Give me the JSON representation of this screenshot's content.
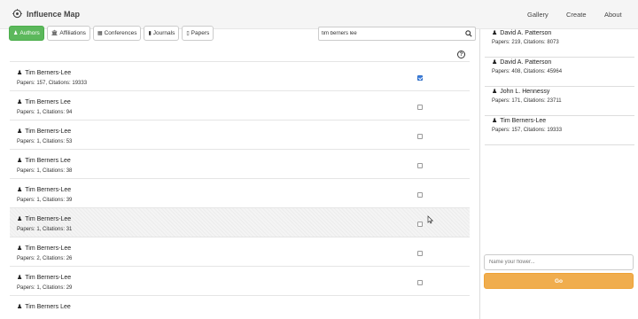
{
  "navbar": {
    "brand_icon": "flower-logo-icon",
    "brand_title": "Influence Map",
    "links": [
      "Gallery",
      "Create",
      "About"
    ]
  },
  "tabs": [
    {
      "label": "Authors",
      "icon": "person-icon",
      "active": true
    },
    {
      "label": "Affiliations",
      "icon": "institution-icon",
      "active": false
    },
    {
      "label": "Conferences",
      "icon": "list-icon",
      "active": false
    },
    {
      "label": "Journals",
      "icon": "book-icon",
      "active": false
    },
    {
      "label": "Papers",
      "icon": "file-icon",
      "active": false
    }
  ],
  "search": {
    "value": "tim berners lee",
    "icon": "search-icon"
  },
  "help_icon": "question-circle-icon",
  "results": [
    {
      "name": "Tim Berners-Lee",
      "stats": "Papers: 157, Citations: 19333",
      "checked": true
    },
    {
      "name": "Tim Berners Lee",
      "stats": "Papers: 1, Citations: 94",
      "checked": false
    },
    {
      "name": "Tim Berners-Lee",
      "stats": "Papers: 1, Citations: 53",
      "checked": false
    },
    {
      "name": "Tim Berners Lee",
      "stats": "Papers: 1, Citations: 38",
      "checked": false
    },
    {
      "name": "Tim Berners-Lee",
      "stats": "Papers: 1, Citations: 39",
      "checked": false
    },
    {
      "name": "Tim Berners-Lee",
      "stats": "Papers: 1, Citations: 31",
      "checked": false
    },
    {
      "name": "Tim Berners-Lee",
      "stats": "Papers: 2, Citations: 26",
      "checked": false
    },
    {
      "name": "Tim Berners-Lee",
      "stats": "Papers: 1, Citations: 29",
      "checked": false
    },
    {
      "name": "Tim Berners Lee",
      "stats": "",
      "checked": false
    }
  ],
  "selected": [
    {
      "name": "David A. Patterson",
      "stats": "Papers: 219, Citations: 8073"
    },
    {
      "name": "David A. Patterson",
      "stats": "Papers: 408, Citations: 45964"
    },
    {
      "name": "John L. Hennessy",
      "stats": "Papers: 171, Citations: 23711"
    },
    {
      "name": "Tim Berners-Lee",
      "stats": "Papers: 157, Citations: 19333"
    }
  ],
  "flower": {
    "placeholder": "Name your flower...",
    "go_label": "Go"
  },
  "colors": {
    "active_tab": "#5cb85c",
    "go_button": "#f0ad4e",
    "checkbox_checked": "#3b7ddd"
  }
}
